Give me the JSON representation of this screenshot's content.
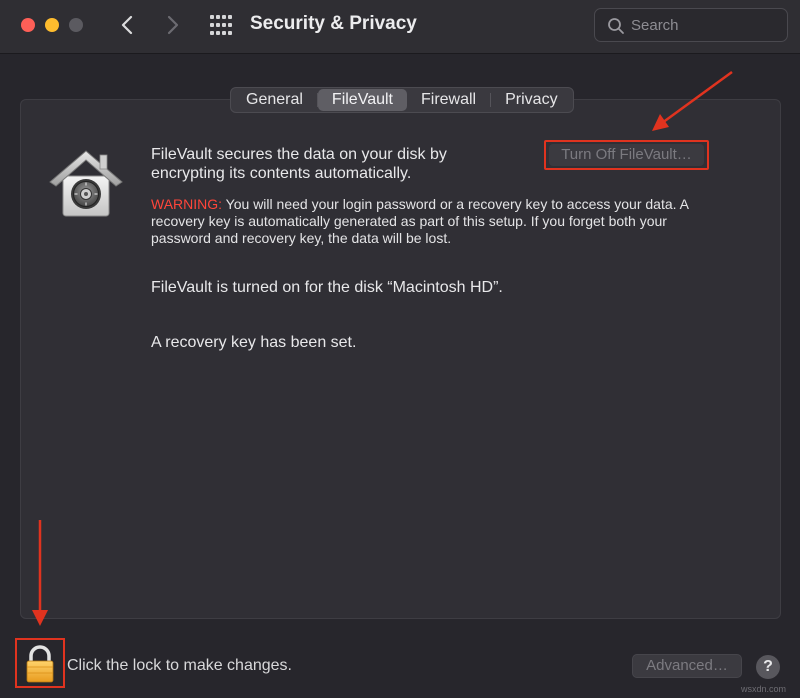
{
  "window": {
    "title": "Security & Privacy"
  },
  "search": {
    "placeholder": "Search",
    "value": ""
  },
  "tabs": [
    {
      "label": "General",
      "active": false
    },
    {
      "label": "FileVault",
      "active": true
    },
    {
      "label": "Firewall",
      "active": false
    },
    {
      "label": "Privacy",
      "active": false
    }
  ],
  "filevault": {
    "description": "FileVault secures the data on your disk by encrypting its contents automatically.",
    "turn_off_label": "Turn Off FileVault…",
    "warning_label": "WARNING:",
    "warning_text": " You will need your login password or a recovery key to access your data. A recovery key is automatically generated as part of this setup. If you forget both your password and recovery key, the data will be lost.",
    "status_disk": "FileVault is turned on for the disk “Macintosh HD”.",
    "status_key": "A recovery key has been set."
  },
  "footer": {
    "lock_text": "Click the lock to make changes.",
    "advanced_label": "Advanced…",
    "help_label": "?"
  },
  "watermark": "wsxdn.com",
  "icons": {
    "back": "chevron-left-icon",
    "forward": "chevron-right-icon",
    "grid": "grid-icon",
    "search": "search-icon",
    "filevault": "filevault-house-icon",
    "lock": "lock-icon"
  },
  "colors": {
    "background": "#27262c",
    "titlebar": "#2f2e33",
    "panel": "#302f35",
    "warning": "#ff453a",
    "annotation": "#e0331f",
    "close": "#fe5f57",
    "minimize": "#febc2e",
    "lock": "#f5b338"
  }
}
